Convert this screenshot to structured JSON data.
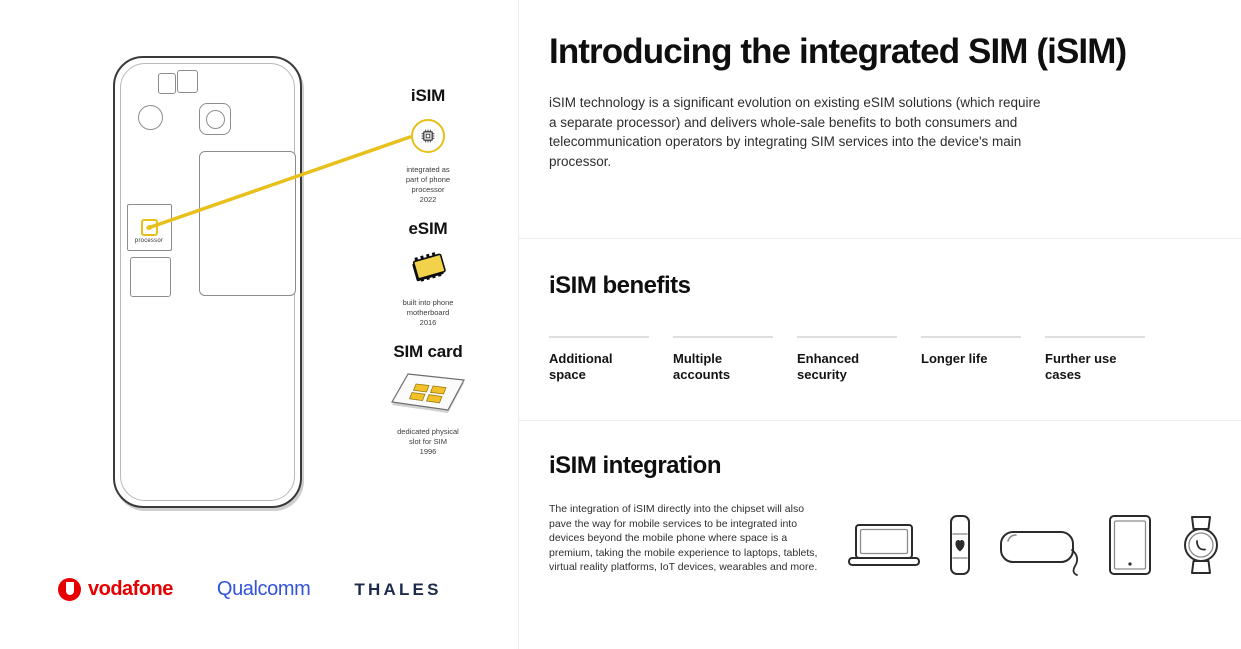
{
  "left_panel": {
    "phone": {
      "processor_label": "processor",
      "chip_icon": "processor-chip-icon"
    },
    "sim_types": [
      {
        "title": "iSIM",
        "icon": "integrated-circuit-icon",
        "caption_lines": [
          "integrated as",
          "part of phone",
          "processor",
          "2022"
        ],
        "year": "2022"
      },
      {
        "title": "eSIM",
        "icon": "esim-chip-icon",
        "caption_lines": [
          "built into phone",
          "motherboard",
          "2016"
        ],
        "year": "2016"
      },
      {
        "title": "SIM card",
        "icon": "sim-card-icon",
        "caption_lines": [
          "dedicated physical",
          "slot for SIM",
          "1996"
        ],
        "year": "1996"
      }
    ],
    "logos": [
      {
        "name": "vodafone",
        "text": "vodafone",
        "color": "#e60000"
      },
      {
        "name": "qualcomm",
        "text": "Qualcomm",
        "color": "#3253dc"
      },
      {
        "name": "thales",
        "text": "THALES",
        "color": "#1d2b4a"
      }
    ]
  },
  "intro": {
    "title": "Introducing the integrated SIM (iSIM)",
    "body": "iSIM technology is a significant evolution on existing eSIM solutions (which require a separate processor) and delivers whole-sale benefits to both consumers and telecommunication operators by integrating SIM services into the device's main processor."
  },
  "benefits": {
    "heading": "iSIM benefits",
    "items": [
      {
        "label": "Additional space"
      },
      {
        "label": "Multiple accounts"
      },
      {
        "label": "Enhanced security"
      },
      {
        "label": "Longer life"
      },
      {
        "label": "Further use cases"
      }
    ]
  },
  "integration": {
    "heading": "iSIM integration",
    "body": "The integration of iSIM directly into the chipset will also pave the way for mobile services to be integrated into devices beyond the mobile phone where space is a premium, taking the mobile experience to laptops, tablets, virtual reality platforms, IoT devices, wearables and more.",
    "devices": [
      {
        "name": "laptop-icon"
      },
      {
        "name": "fitness-tracker-icon"
      },
      {
        "name": "vr-headset-icon"
      },
      {
        "name": "tablet-icon"
      },
      {
        "name": "smartwatch-icon"
      }
    ]
  },
  "colors": {
    "accent_yellow": "#e8c01c",
    "vodafone_red": "#e60000",
    "qualcomm_blue": "#3253dc",
    "thales_navy": "#1d2b4a",
    "rule_gray": "#dedede"
  }
}
